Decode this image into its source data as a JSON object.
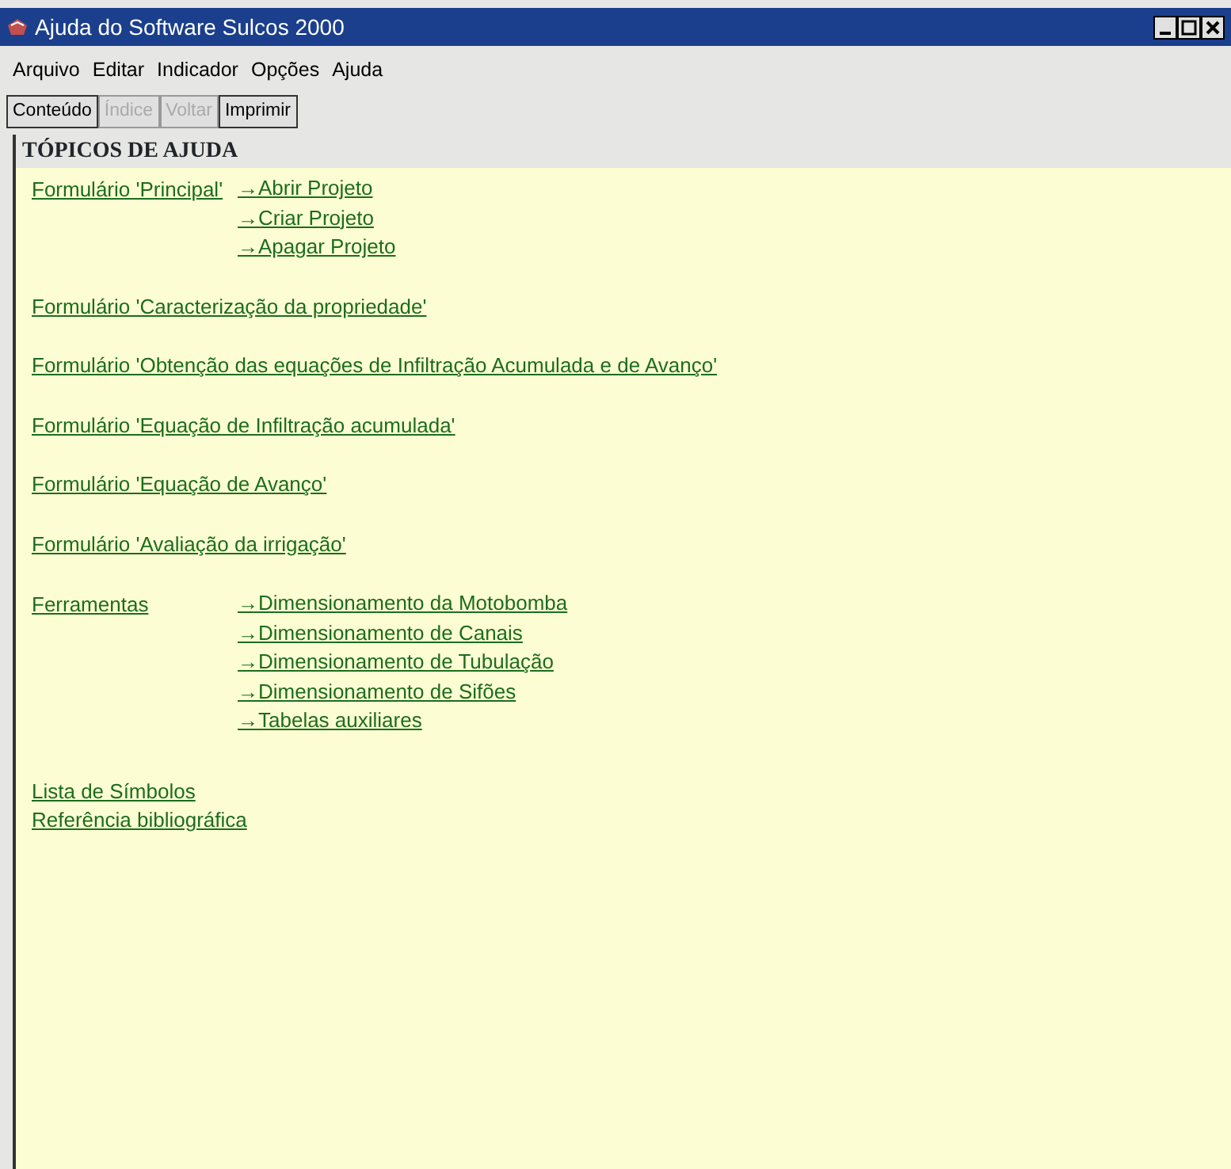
{
  "window": {
    "title": "Ajuda do Software Sulcos 2000"
  },
  "menu": [
    "Arquivo",
    "Editar",
    "Indicador",
    "Opções",
    "Ajuda"
  ],
  "toolbar": [
    {
      "label": "Conteúdo",
      "disabled": false
    },
    {
      "label": "Índice",
      "disabled": true
    },
    {
      "label": "Voltar",
      "disabled": true
    },
    {
      "label": "Imprimir",
      "disabled": false
    }
  ],
  "header": "TÓPICOS DE AJUDA",
  "topics": [
    {
      "label": "Formulário 'Principal'",
      "links": [
        "→Abrir Projeto",
        "→Criar Projeto",
        "→Apagar Projeto"
      ]
    },
    {
      "label": "Formulário 'Caracterização da propriedade'"
    },
    {
      "label": "Formulário 'Obtenção das equações de Infiltração Acumulada e de Avanço'"
    },
    {
      "label": "Formulário 'Equação de Infiltração acumulada'"
    },
    {
      "label": "Formulário 'Equação de Avanço'"
    },
    {
      "label": "Formulário 'Avaliação da irrigação'"
    },
    {
      "label": "Ferramentas",
      "links": [
        "→Dimensionamento da Motobomba",
        "→Dimensionamento de Canais",
        "→Dimensionamento de Tubulação",
        "→Dimensionamento de Sifões",
        "→Tabelas auxiliares"
      ]
    }
  ],
  "reference_links": [
    {
      "label": "Lista de Símbolos"
    },
    {
      "label": "Referência bibliográfica"
    }
  ]
}
